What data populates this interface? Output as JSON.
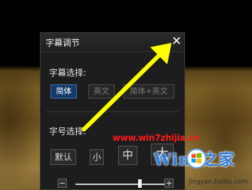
{
  "dialog": {
    "title": "字幕调节",
    "close_glyph": "✕",
    "subtitle_select": {
      "label": "字幕选择:",
      "options": [
        "简体",
        "英文",
        "简体+英文"
      ],
      "selected": "简体"
    },
    "font_size": {
      "label": "字号选择:",
      "buttons": [
        "默认",
        "小",
        "中",
        "大"
      ]
    },
    "slider": {
      "minus": "−",
      "plus": "+",
      "level": 0.72
    }
  },
  "watermark": {
    "url": "www.win7zhijia.cn",
    "brand": "Win7之家",
    "site": "jingyan.baidu.com"
  },
  "colors": {
    "arrow": "#ffff00",
    "selected_button": "#163a6a",
    "watermark_url": "#ff1a1a",
    "watermark_brand": "#2f7de0"
  }
}
